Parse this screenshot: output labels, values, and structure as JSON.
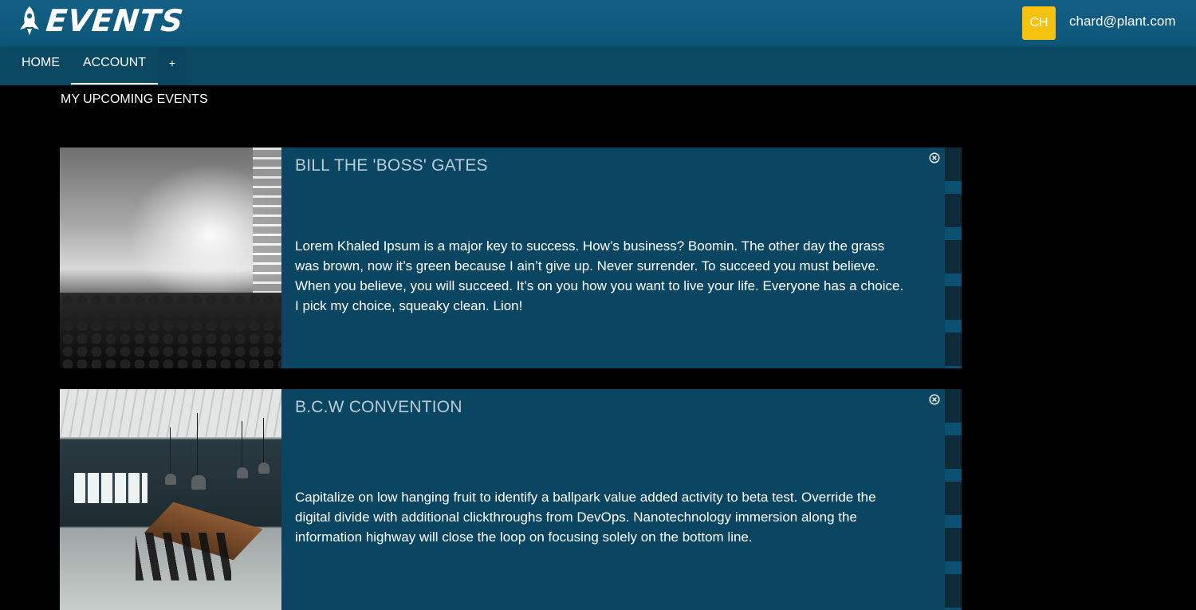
{
  "header": {
    "brand": "EVENTS",
    "avatar_initials": "CH",
    "user_email": "chard@plant.com",
    "avatar_color": "#f5c211",
    "bar_color": "#0d5678"
  },
  "nav": {
    "tabs": [
      {
        "label": "HOME",
        "active": false
      },
      {
        "label": "ACCOUNT",
        "active": true
      },
      {
        "label": "+",
        "active": false
      }
    ]
  },
  "main": {
    "section_title": "MY UPCOMING EVENTS",
    "events": [
      {
        "title": "BILL THE 'BOSS' GATES",
        "image": "concert-crowd-photo",
        "description": "Lorem Khaled Ipsum is a major key to success. How’s business? Boomin. The other day the grass was brown, now it’s green because I ain’t give up. Never surrender. To succeed you must believe. When you believe, you will succeed. It’s on you how you want to live your life. Everyone has a choice. I pick my choice, squeaky clean. Lion!"
      },
      {
        "title": "B.C.W CONVENTION",
        "image": "office-dining-room-photo",
        "description": "Capitalize on low hanging fruit to identify a ballpark value added activity to beta test. Override the digital divide with additional clickthroughs from DevOps. Nanotechnology immersion along the information highway will close the loop on focusing solely on the bottom line."
      }
    ]
  }
}
